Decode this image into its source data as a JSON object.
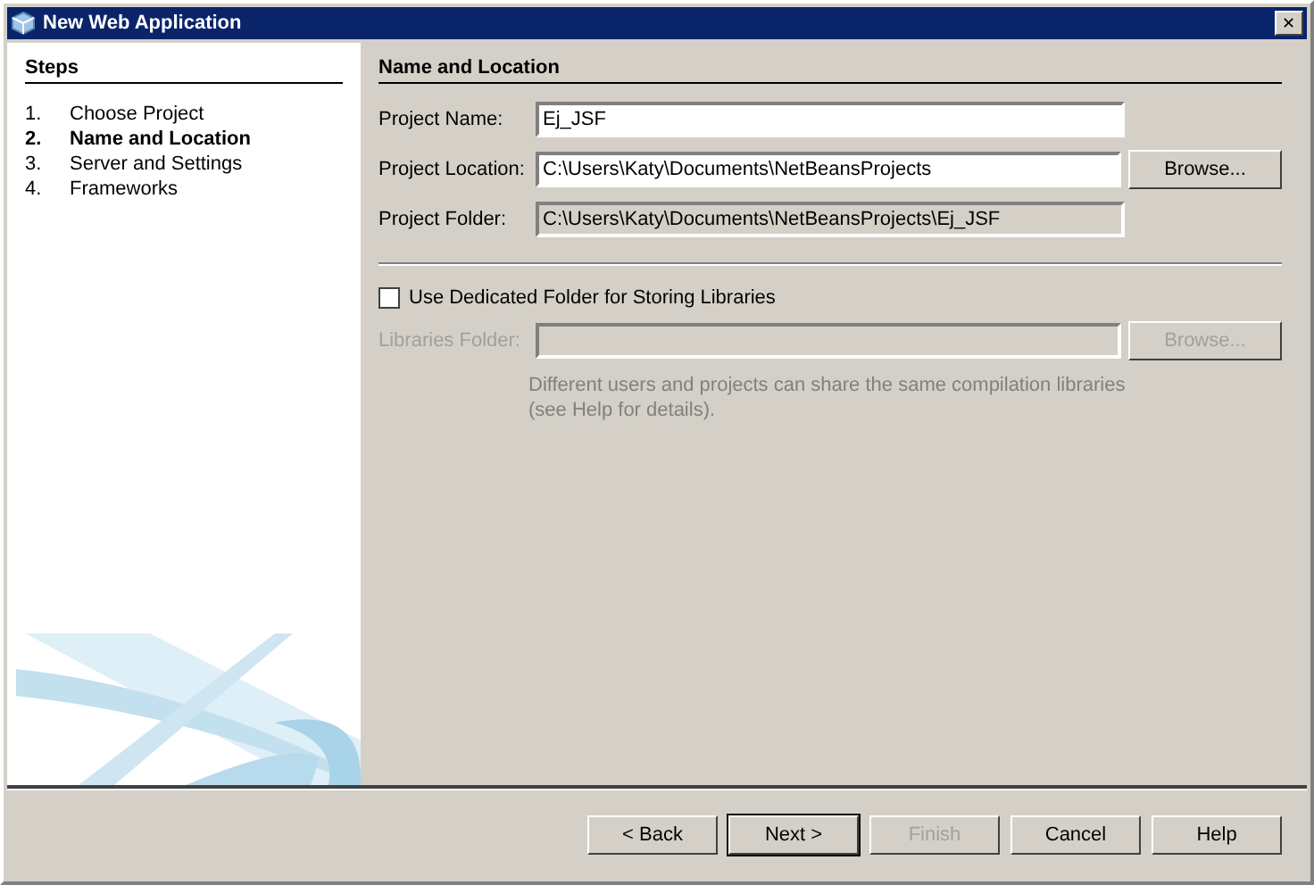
{
  "window": {
    "title": "New Web Application",
    "close": "✕"
  },
  "steps": {
    "title": "Steps",
    "items": [
      {
        "number": "1.",
        "label": "Choose Project",
        "selected": false
      },
      {
        "number": "2.",
        "label": "Name and Location",
        "selected": true
      },
      {
        "number": "3.",
        "label": "Server and Settings",
        "selected": false
      },
      {
        "number": "4.",
        "label": "Frameworks",
        "selected": false
      }
    ]
  },
  "panel": {
    "title": "Name and Location",
    "fields": [
      {
        "label": "Project Name:",
        "value": "Ej_JSF",
        "disabled": false
      },
      {
        "label": "Project Location:",
        "value": "C:\\Users\\Katy\\Documents\\NetBeansProjects",
        "disabled": false,
        "button": {
          "label": "Browse...",
          "disabled": false
        }
      },
      {
        "label": "Project Folder:",
        "value": "C:\\Users\\Katy\\Documents\\NetBeansProjects\\Ej_JSF",
        "disabled": true
      }
    ],
    "checkbox": {
      "label": "Use Dedicated Folder for Storing Libraries",
      "checked": false
    },
    "libraries": {
      "label": "Libraries Folder:",
      "disabled": true,
      "button": {
        "label": "Browse...",
        "disabled": true
      }
    },
    "hint": "Different users and projects can share the same compilation libraries (see Help for details)."
  },
  "buttons": [
    {
      "label": "< Back",
      "disabled": false,
      "default": false
    },
    {
      "label": "Next >",
      "disabled": false,
      "default": true
    },
    {
      "label": "Finish",
      "disabled": true,
      "default": false
    },
    {
      "label": "Cancel",
      "disabled": false,
      "default": false
    },
    {
      "label": "Help",
      "disabled": false,
      "default": false
    }
  ]
}
